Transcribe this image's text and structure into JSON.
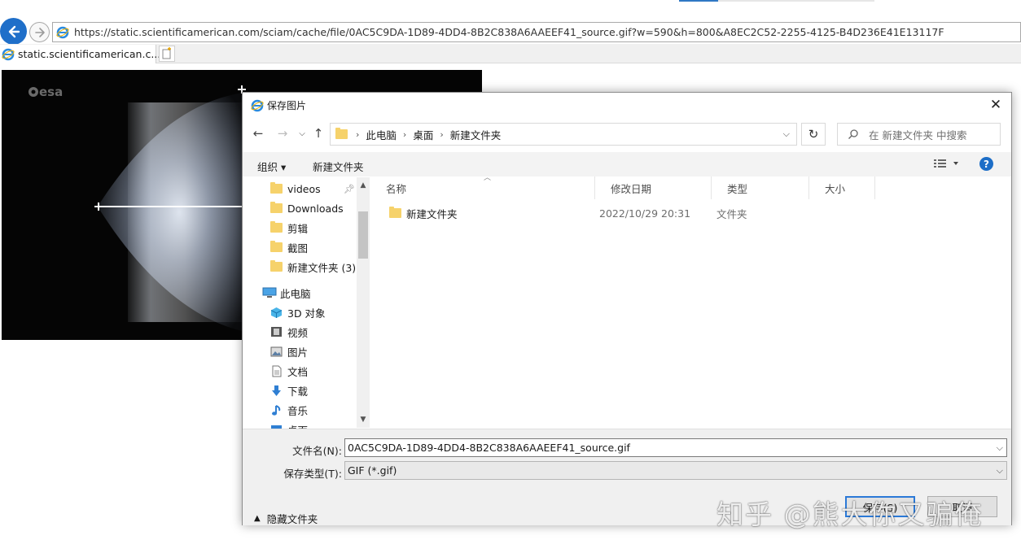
{
  "browser": {
    "url": "https://static.scientificamerican.com/sciam/cache/file/0AC5C9DA-1D89-4DD4-8B2C838A6AAEEF41_source.gif?w=590&h=800&A8EC2C52-2255-4125-B4D236E41E13117F",
    "tab_title": "static.scientificamerican.c...",
    "tab_close": "×"
  },
  "page_image": {
    "logo_text": "esa"
  },
  "dialog": {
    "title": "保存图片",
    "close": "✕",
    "breadcrumb": [
      "此电脑",
      "桌面",
      "新建文件夹"
    ],
    "search_placeholder": "在 新建文件夹 中搜索",
    "toolbar": {
      "organize": "组织 ▾",
      "new_folder": "新建文件夹",
      "help": "?"
    },
    "tree": [
      {
        "label": "videos",
        "icon": "folder-icon",
        "pinned": true
      },
      {
        "label": "Downloads",
        "icon": "folder-icon"
      },
      {
        "label": "剪辑",
        "icon": "folder-icon"
      },
      {
        "label": "截图",
        "icon": "folder-icon"
      },
      {
        "label": "新建文件夹 (3)",
        "icon": "folder-icon"
      },
      {
        "label": "此电脑",
        "icon": "computer-icon"
      },
      {
        "label": "3D 对象",
        "icon": "cube-icon"
      },
      {
        "label": "视频",
        "icon": "video-icon"
      },
      {
        "label": "图片",
        "icon": "picture-icon"
      },
      {
        "label": "文档",
        "icon": "document-icon"
      },
      {
        "label": "下载",
        "icon": "download-icon"
      },
      {
        "label": "音乐",
        "icon": "music-icon"
      },
      {
        "label": "桌面",
        "icon": "desktop-icon"
      }
    ],
    "columns": [
      "名称",
      "修改日期",
      "类型",
      "大小"
    ],
    "files": [
      {
        "name": "新建文件夹",
        "date": "2022/10/29 20:31",
        "type": "文件夹",
        "size": ""
      }
    ],
    "filename_label": "文件名(N):",
    "filename_value": "0AC5C9DA-1D89-4DD4-8B2C838A6AAEEF41_source.gif",
    "filetype_label": "保存类型(T):",
    "filetype_value": "GIF (*.gif)",
    "hide_folders": "隐藏文件夹",
    "save_button": "保存(S)",
    "cancel_button": "取消"
  },
  "watermark": "知乎 @熊大你又骗俺"
}
